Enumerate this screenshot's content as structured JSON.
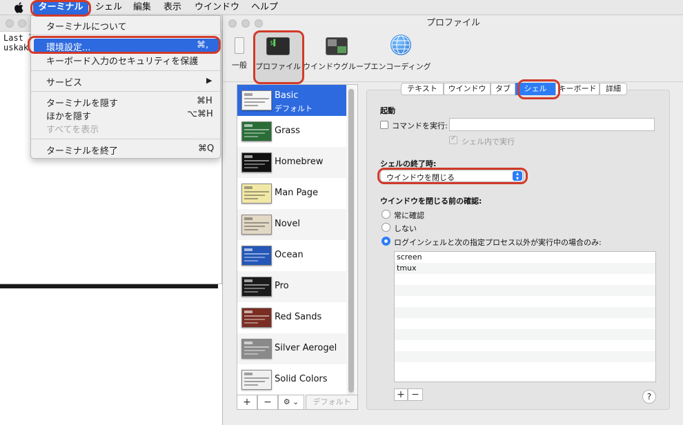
{
  "menubar": {
    "apple": "apple-icon",
    "items": [
      "ターミナル",
      "シェル",
      "編集",
      "表示",
      "ウインドウ",
      "ヘルプ"
    ]
  },
  "menu": {
    "items": [
      {
        "label": "ターミナルについて",
        "shortcut": ""
      },
      {
        "label": "環境設定...",
        "shortcut": "⌘,"
      },
      {
        "label": "キーボード入力のセキュリティを保護",
        "shortcut": ""
      },
      {
        "label": "サービス",
        "shortcut": "▶"
      },
      {
        "label": "ターミナルを隠す",
        "shortcut": "⌘H"
      },
      {
        "label": "ほかを隠す",
        "shortcut": "⌥⌘H"
      },
      {
        "label": "すべてを表示",
        "shortcut": ""
      },
      {
        "label": "ターミナルを終了",
        "shortcut": "⌘Q"
      }
    ]
  },
  "terminal": {
    "lines": [
      "Last l",
      "uskak"
    ]
  },
  "prefs": {
    "title": "プロファイル",
    "toolbar": [
      {
        "label": "一般",
        "icon": "switch-icon"
      },
      {
        "label": "プロファイル",
        "icon": "terminal-icon"
      },
      {
        "label": "ウインドウグループ",
        "icon": "window-group-icon"
      },
      {
        "label": "エンコーディング",
        "icon": "globe-icon"
      }
    ],
    "profiles": [
      {
        "name": "Basic",
        "sub": "デフォルト",
        "color": "#f5f5f5"
      },
      {
        "name": "Grass",
        "color": "#2a6d37"
      },
      {
        "name": "Homebrew",
        "color": "#111111"
      },
      {
        "name": "Man Page",
        "color": "#f2e8a6"
      },
      {
        "name": "Novel",
        "color": "#e2d8c4"
      },
      {
        "name": "Ocean",
        "color": "#2457b8"
      },
      {
        "name": "Pro",
        "color": "#1b1b1b"
      },
      {
        "name": "Red Sands",
        "color": "#7a2d22"
      },
      {
        "name": "Silver Aerogel",
        "color": "#8a8a8a"
      },
      {
        "name": "Solid Colors",
        "color": "#f0f0f0"
      }
    ],
    "list_footer": {
      "add": "+",
      "remove": "−",
      "gear": "⚙︎ ⌄",
      "default": "デフォルト"
    },
    "tabs": [
      "テキスト",
      "ウインドウ",
      "タブ",
      "シェル",
      "キーボード",
      "詳細"
    ],
    "selected_tab": "シェル",
    "shell": {
      "startup_label": "起動",
      "run_command_label": "コマンドを実行:",
      "run_in_shell_label": "シェル内で実行",
      "on_exit_label": "シェルの終了時:",
      "on_exit_value": "ウインドウを閉じる",
      "confirm_label": "ウインドウを閉じる前の確認:",
      "options": [
        "常に確認",
        "しない",
        "ログインシェルと次の指定プロセス以外が実行中の場合のみ:"
      ],
      "processes": [
        "screen",
        "tmux"
      ],
      "add": "+",
      "remove": "−",
      "help": "?"
    }
  },
  "accent": "#2d6ae0",
  "highlight": "#d23a2a"
}
